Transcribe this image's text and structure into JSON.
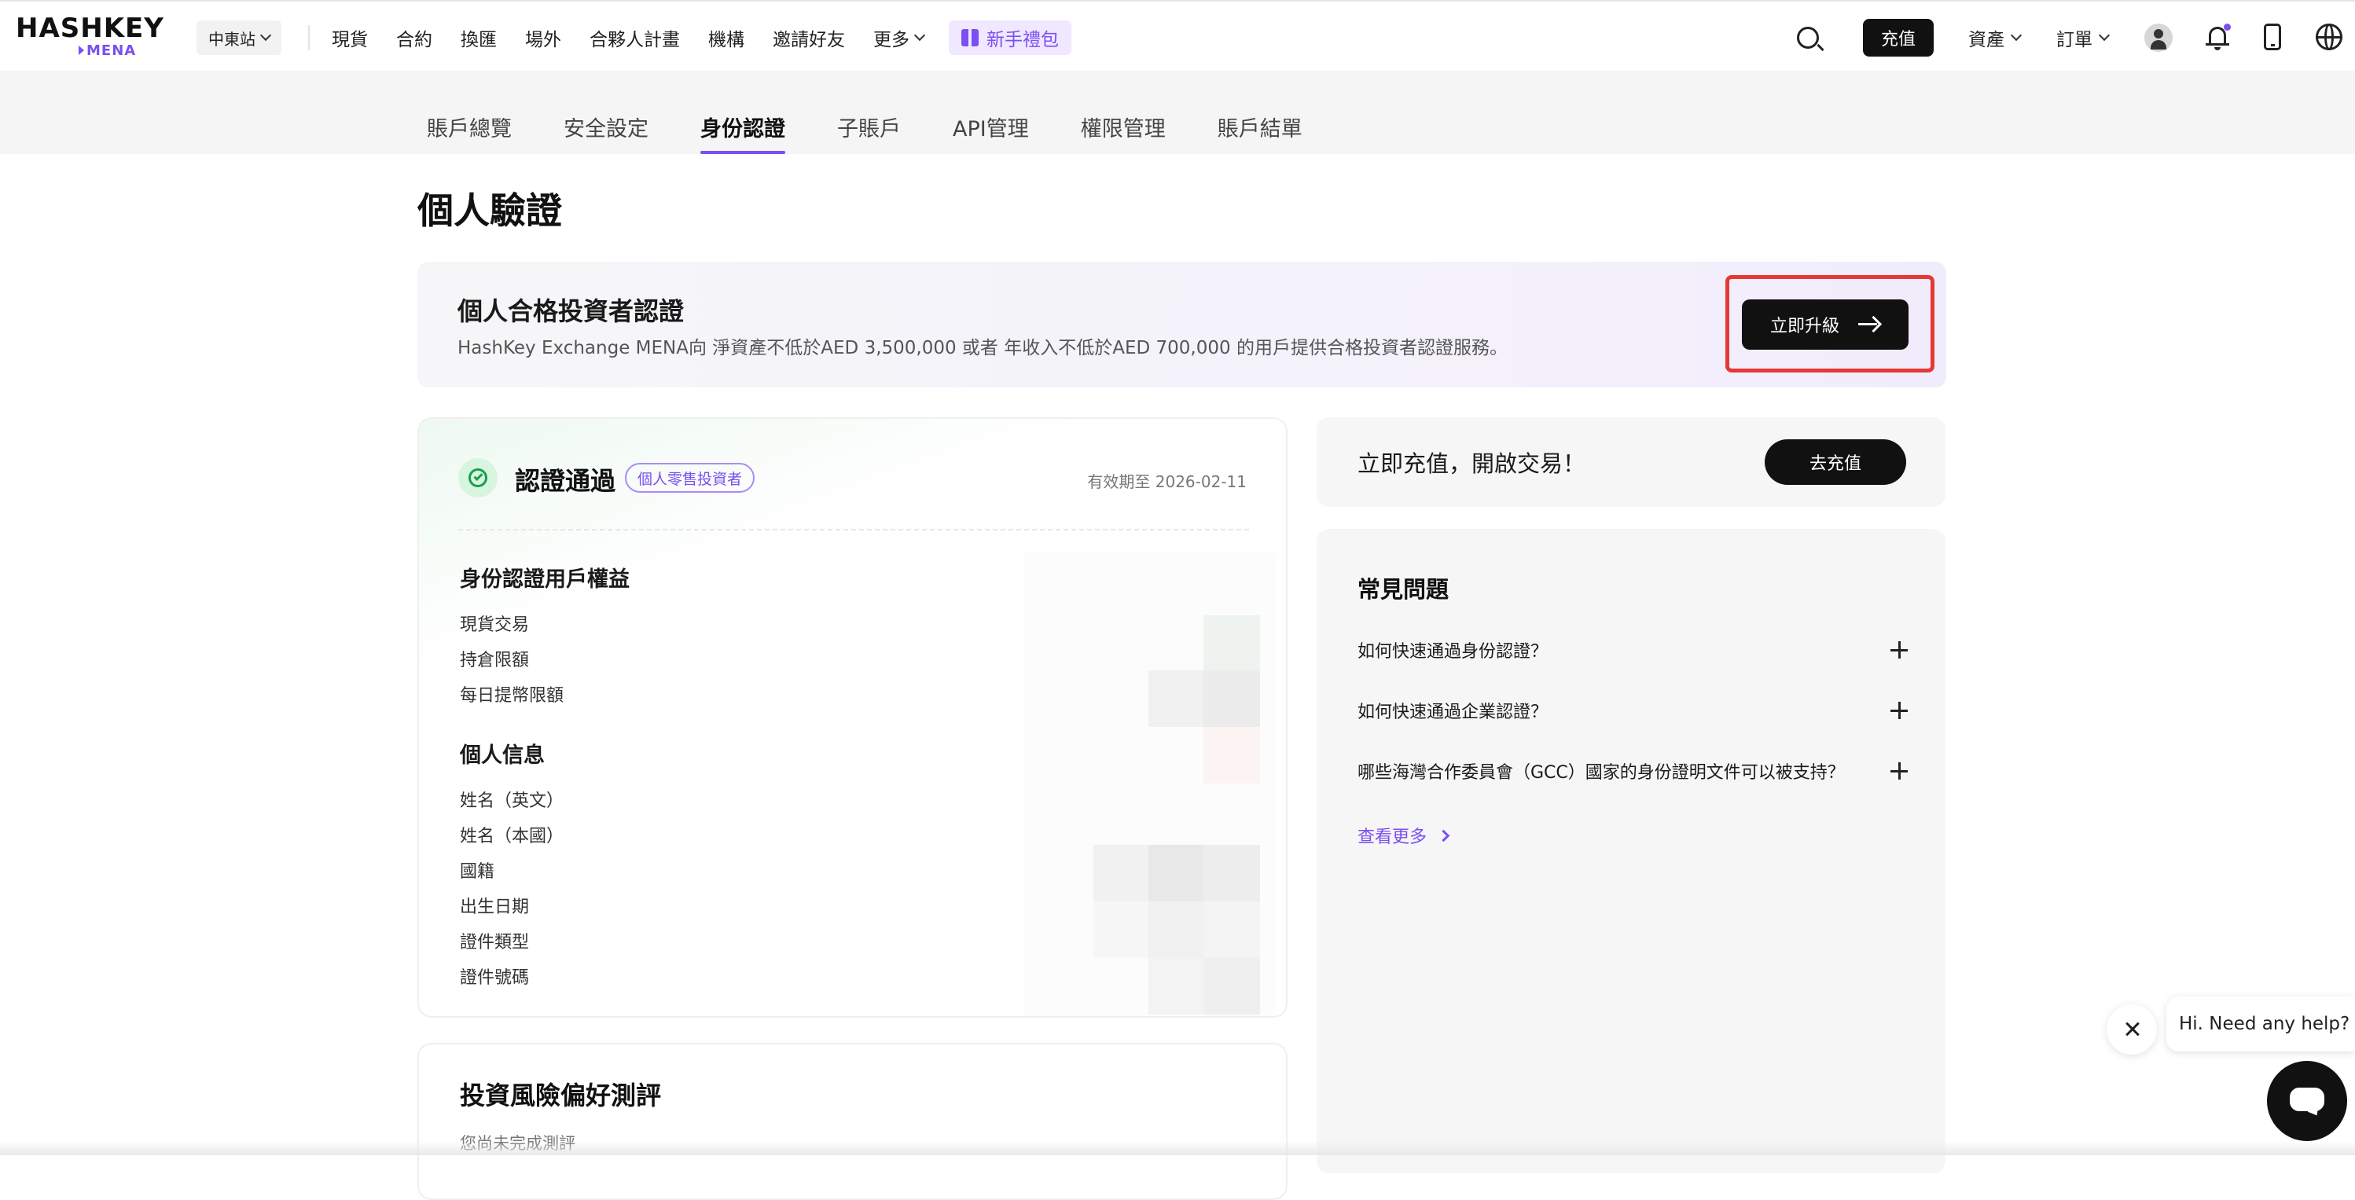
{
  "header": {
    "logo_main": "HASHKEY",
    "logo_sub": "MENA",
    "region": "中東站",
    "nav": [
      "現貨",
      "合約",
      "換匯",
      "場外",
      "合夥人計畫",
      "機構",
      "邀請好友"
    ],
    "more": "更多",
    "gift": "新手禮包",
    "deposit": "充值",
    "assets": "資產",
    "orders": "訂單"
  },
  "tabs": [
    "賬戶總覽",
    "安全設定",
    "身份認證",
    "子賬戶",
    "API管理",
    "權限管理",
    "賬戶結單"
  ],
  "active_tab": "身份認證",
  "page_title": "個人驗證",
  "banner": {
    "title": "個人合格投資者認證",
    "desc": "HashKey Exchange MENA向 淨資產不低於AED 3,500,000 或者 年收入不低於AED 700,000 的用戶提供合格投資者認證服務。",
    "button": "立即升級"
  },
  "verification": {
    "status": "認證通過",
    "badge": "個人零售投資者",
    "valid_until": "有效期至 2026-02-11",
    "benefits_title": "身份認證用戶權益",
    "benefits": [
      "現貨交易",
      "持倉限額",
      "每日提幣限額"
    ],
    "info_title": "個人信息",
    "info": [
      "姓名（英文）",
      "姓名（本國）",
      "國籍",
      "出生日期",
      "證件類型",
      "證件號碼"
    ]
  },
  "risk": {
    "title": "投資風險偏好測評",
    "subtitle": "您尚未完成測評"
  },
  "deposit_card": {
    "text": "立即充值，開啟交易！",
    "button": "去充值"
  },
  "faq": {
    "title": "常見問題",
    "items": [
      "如何快速通過身份認證？",
      "如何快速通過企業認證？",
      "哪些海灣合作委員會（GCC）國家的身份證明文件可以被支持？"
    ],
    "more": "查看更多"
  },
  "chat": {
    "message": "Hi. Need any help?"
  },
  "colors": {
    "accent": "#7b4ff0",
    "success": "#1b9e4b",
    "highlight": "#e53935"
  }
}
